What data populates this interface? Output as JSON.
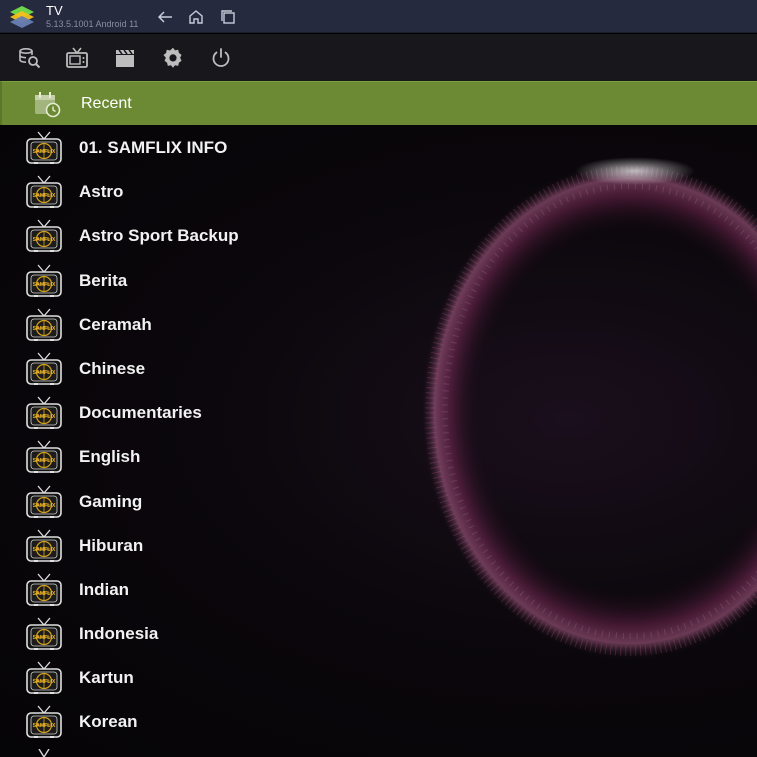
{
  "window": {
    "title": "TV",
    "version": "5.13.5.1001  Android 11"
  },
  "toolbar": {
    "icons": [
      "search-icon",
      "tv-icon",
      "movies-icon",
      "settings-icon",
      "power-icon"
    ]
  },
  "recent": {
    "label": "Recent"
  },
  "channel_logo_text": "SAMFLIX",
  "categories": [
    "01. SAMFLIX INFO",
    "Astro",
    "Astro Sport Backup",
    "Berita",
    "Ceramah",
    "Chinese",
    "Documentaries",
    "English",
    "Gaming",
    "Hiburan",
    "Indian",
    "Indonesia",
    "Kartun",
    "Korean"
  ],
  "colors": {
    "titlebar": "#262a3e",
    "toolbar": "#18181c",
    "recent_highlight": "#6c8a33",
    "logo_gold": "#d6a21c"
  }
}
